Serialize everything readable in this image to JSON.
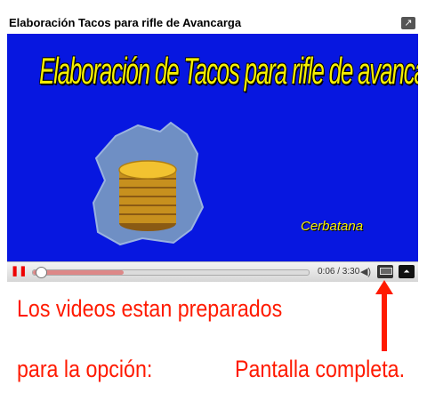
{
  "header": {
    "title": "Elaboración Tacos para rifle de Avancarga",
    "share_icon": "share-arrow-icon",
    "share_glyph": "↗"
  },
  "video": {
    "overlay_title": "Elaboración de Tacos para rifle de avancarga",
    "credit": "Cerbatana",
    "background_color": "#0717e0",
    "text_color": "#f5ef00"
  },
  "controls": {
    "play_glyph": "❚❚",
    "current_time": "0:06",
    "duration": "3:30",
    "time_display": "0:06 / 3:30",
    "progress_fraction": 0.029,
    "buffered_fraction": 0.33,
    "volume_glyph": "◀)",
    "fullscreen_glyph": "⏶"
  },
  "annotation": {
    "line1": "Los videos estan preparados",
    "line2": "para la opción:",
    "line3": "Pantalla completa.",
    "color": "#ff1a00"
  }
}
